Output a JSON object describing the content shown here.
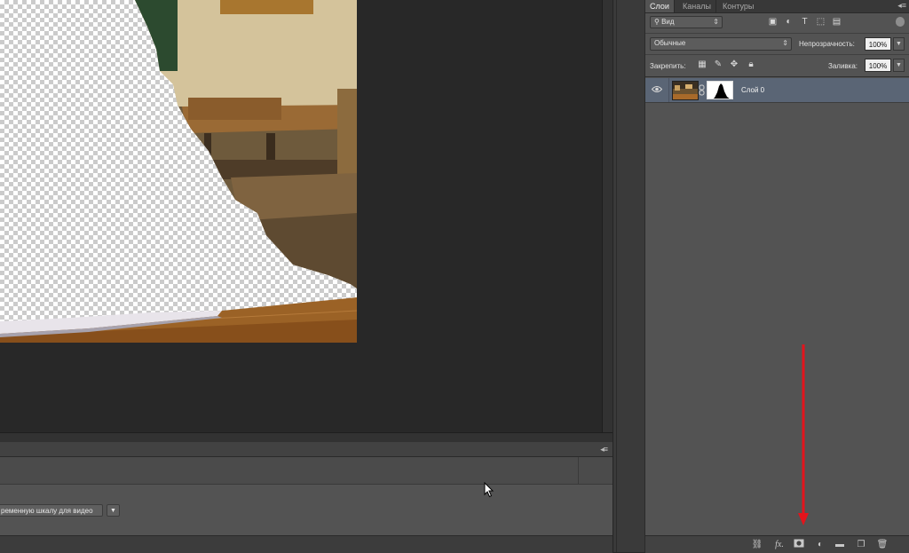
{
  "layers_panel": {
    "tabs": [
      {
        "label": "Слои",
        "active": true
      },
      {
        "label": "Каналы",
        "active": false
      },
      {
        "label": "Контуры",
        "active": false
      }
    ],
    "filter": {
      "kind_label": "Вид"
    },
    "blend_mode": "Обычные",
    "opacity_label": "Непрозрачность:",
    "opacity_value": "100%",
    "lock_label": "Закрепить:",
    "fill_label": "Заливка:",
    "fill_value": "100%",
    "layers": [
      {
        "name": "Слой 0",
        "visible": true,
        "selected": true,
        "has_mask": true
      }
    ],
    "bottom_icons": [
      "link-icon",
      "fx-icon",
      "add-mask-icon",
      "adjustment-icon",
      "folder-icon",
      "new-layer-icon",
      "trash-icon"
    ],
    "annotation": {
      "type": "red-arrow",
      "points_to": "add-mask-icon",
      "color": "#e3141c"
    }
  },
  "timeline": {
    "create_button_label": "ременную шкалу для видео"
  },
  "colors": {
    "selected_layer_row": "#5a6575",
    "panel_bg": "#535353",
    "canvas_bg": "#282828"
  }
}
